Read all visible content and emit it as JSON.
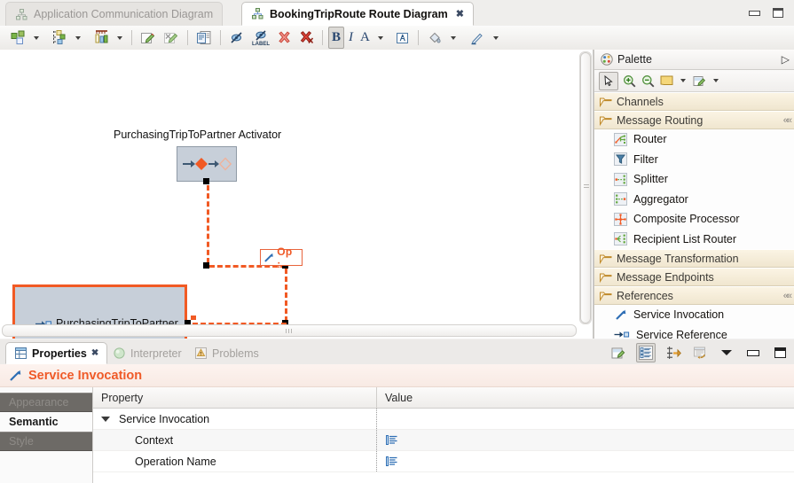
{
  "window": {
    "minimize_label": "minimize",
    "maximize_label": "maximize"
  },
  "editor_tabs": [
    {
      "label": "Application Communication Diagram",
      "icon": "diagram-icon",
      "active": false
    },
    {
      "label": "BookingTripRoute Route Diagram",
      "icon": "diagram-icon",
      "active": true,
      "close": "✖"
    }
  ],
  "toolbar": {
    "items": [
      {
        "name": "arrange-all",
        "kind": "icon-dropdown"
      },
      {
        "name": "align",
        "kind": "icon-dropdown"
      },
      {
        "name": "distribute",
        "kind": "icon-dropdown"
      },
      {
        "name": "select-pen",
        "kind": "icon"
      },
      {
        "name": "deselect-pen",
        "kind": "icon"
      },
      {
        "name": "show-related-elements",
        "kind": "icon"
      },
      {
        "name": "hide-element",
        "kind": "icon"
      },
      {
        "name": "hide-label",
        "kind": "icon",
        "caption": "LABEL"
      },
      {
        "name": "delete-from-diagram",
        "kind": "icon"
      },
      {
        "name": "delete-from-model",
        "kind": "icon"
      },
      {
        "name": "bold",
        "kind": "toggle",
        "glyph": "B",
        "pressed": true
      },
      {
        "name": "italic",
        "kind": "toggle",
        "glyph": "I",
        "pressed": false
      },
      {
        "name": "font-color",
        "kind": "icon-dropdown",
        "glyph": "A"
      },
      {
        "name": "font-dialog",
        "kind": "icon"
      },
      {
        "name": "fill-color",
        "kind": "icon-dropdown"
      },
      {
        "name": "line-color",
        "kind": "icon-dropdown"
      }
    ]
  },
  "diagram": {
    "activator": {
      "label": "PurchasingTripToPartner Activator",
      "icon": "activator-icon"
    },
    "operation_node": {
      "label": "Op :",
      "icon": "service-invocation-icon"
    },
    "selected_node": {
      "label": "PurchasingTripToPartner",
      "icon": "service-reference-icon",
      "selected": true
    },
    "connection_color": "#f15a24",
    "node_fill": "#c7cfd9",
    "selection_color": "#f15a24"
  },
  "palette": {
    "title": "Palette",
    "header_icon": "palette-icon",
    "collapse_icon": "chevron-right-icon",
    "tools": [
      {
        "name": "select-tool",
        "icon": "cursor-icon"
      },
      {
        "name": "zoom-in-tool",
        "icon": "zoom-in-icon"
      },
      {
        "name": "zoom-out-tool",
        "icon": "zoom-out-icon"
      },
      {
        "name": "note-tool",
        "icon": "note-icon",
        "dropdown": true
      },
      {
        "name": "note-attachment-tool",
        "icon": "note-attachment-icon",
        "dropdown": true
      }
    ],
    "groups": [
      {
        "label": "Channels",
        "expanded": false,
        "items": []
      },
      {
        "label": "Message Routing",
        "expanded": true,
        "items": [
          {
            "label": "Router",
            "icon": "router-icon"
          },
          {
            "label": "Filter",
            "icon": "filter-icon"
          },
          {
            "label": "Splitter",
            "icon": "splitter-icon"
          },
          {
            "label": "Aggregator",
            "icon": "aggregator-icon"
          },
          {
            "label": "Composite Processor",
            "icon": "composite-processor-icon"
          },
          {
            "label": "Recipient List Router",
            "icon": "recipient-list-router-icon"
          }
        ]
      },
      {
        "label": "Message Transformation",
        "expanded": false,
        "items": []
      },
      {
        "label": "Message Endpoints",
        "expanded": false,
        "items": []
      },
      {
        "label": "References",
        "expanded": true,
        "items": [
          {
            "label": "Service Invocation",
            "icon": "service-invocation-icon"
          },
          {
            "label": "Service Reference",
            "icon": "service-reference-icon"
          }
        ]
      }
    ]
  },
  "properties_view": {
    "tabs": [
      {
        "label": "Properties",
        "icon": "properties-icon",
        "active": true,
        "close": "✖"
      },
      {
        "label": "Interpreter",
        "icon": "interpreter-icon",
        "active": false
      },
      {
        "label": "Problems",
        "icon": "problems-icon",
        "active": false
      }
    ],
    "toolbar": [
      {
        "name": "new-tab",
        "icon": "new-tab-icon",
        "pressed": false
      },
      {
        "name": "show-categories",
        "icon": "categories-icon",
        "pressed": true
      },
      {
        "name": "show-advanced",
        "icon": "advanced-icon",
        "pressed": false
      },
      {
        "name": "restore-defaults",
        "icon": "restore-icon",
        "pressed": false
      },
      {
        "name": "view-menu",
        "icon": "view-menu-icon",
        "pressed": false
      },
      {
        "name": "minimize-view",
        "icon": "minimize-icon",
        "pressed": false
      },
      {
        "name": "maximize-view",
        "icon": "maximize-icon",
        "pressed": false
      }
    ],
    "title": "Service Invocation",
    "title_icon": "service-invocation-icon",
    "title_color": "#ef5a28",
    "side_tabs": [
      {
        "label": "Appearance",
        "selected": false
      },
      {
        "label": "Semantic",
        "selected": true
      },
      {
        "label": "Style",
        "selected": false
      }
    ],
    "table": {
      "columns": [
        "Property",
        "Value"
      ],
      "rows": [
        {
          "label": "Service Invocation",
          "value": "",
          "level": 0,
          "expanded": true,
          "value_icon": ""
        },
        {
          "label": "Context",
          "value": "",
          "level": 1,
          "expanded": null,
          "value_icon": "text-edit-icon"
        },
        {
          "label": "Operation Name",
          "value": "",
          "level": 1,
          "expanded": null,
          "value_icon": "text-edit-icon"
        }
      ]
    }
  }
}
